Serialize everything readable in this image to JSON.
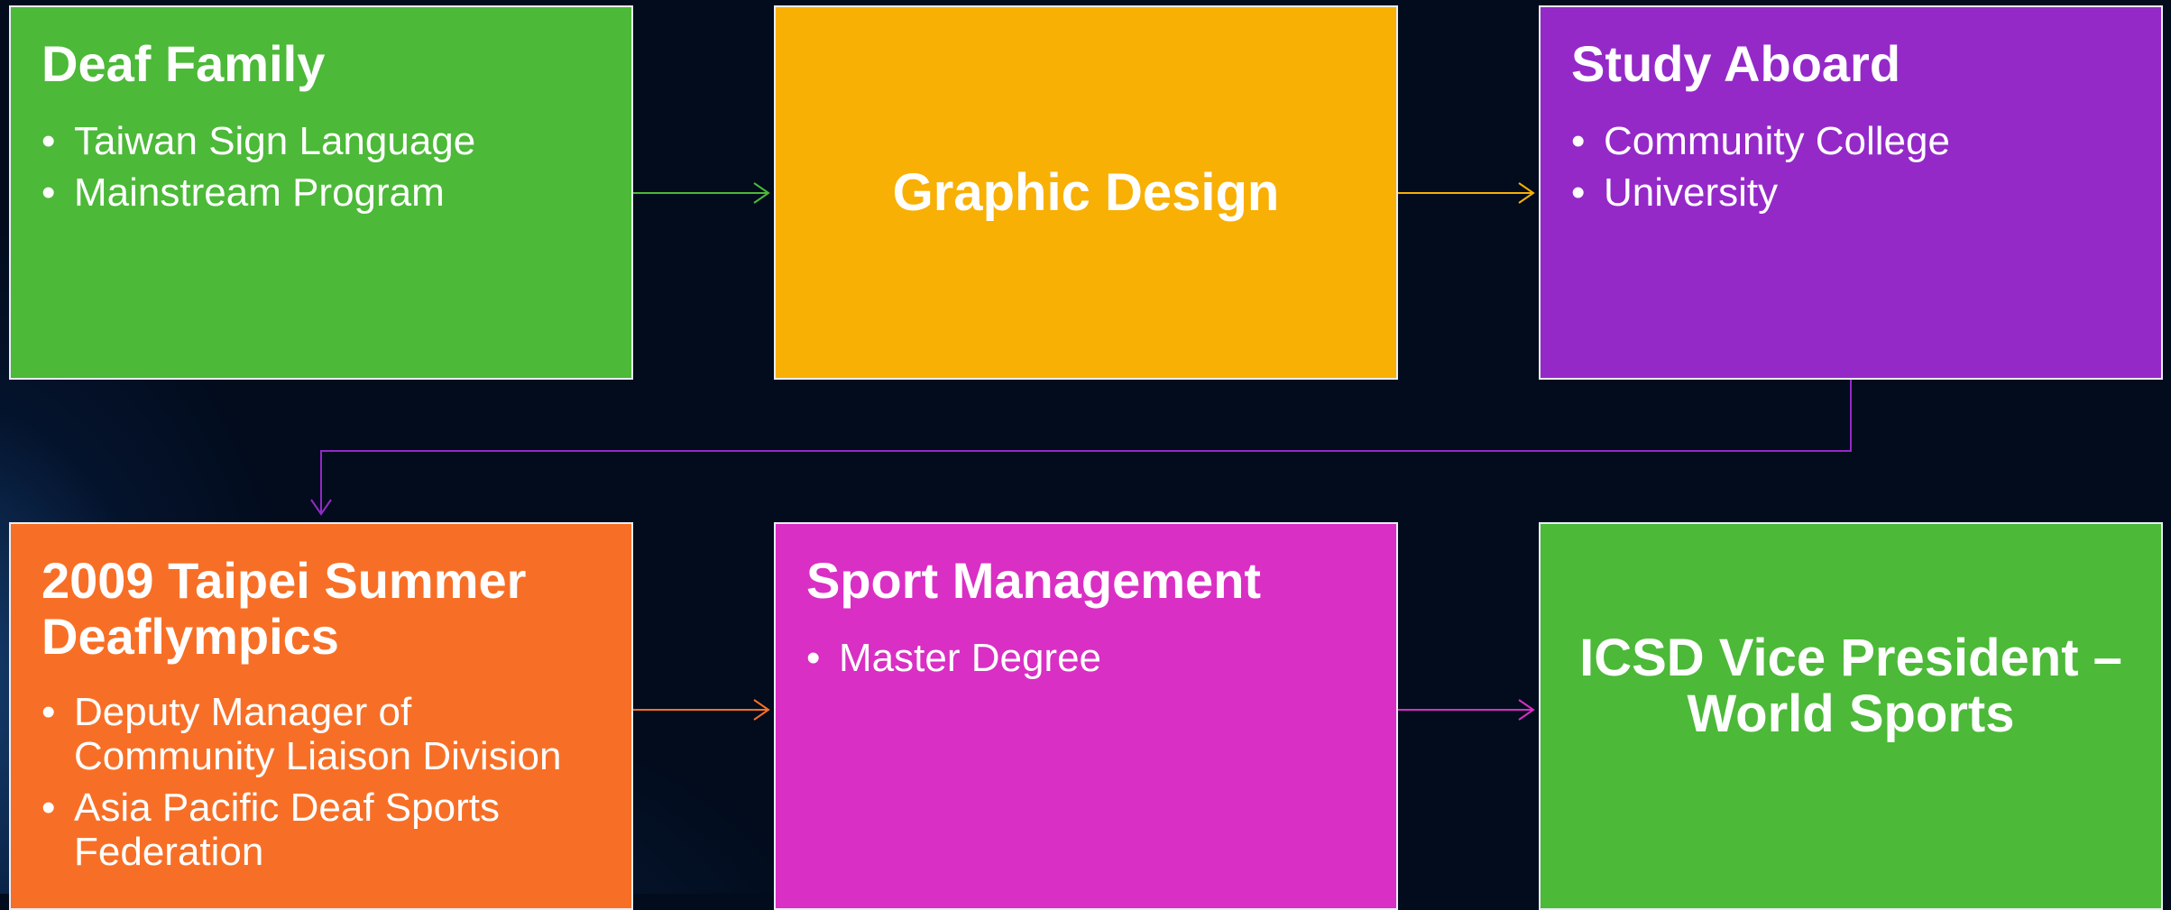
{
  "colors": {
    "background": "#020c1d",
    "green": "#4cb938",
    "yellow": "#f8b005",
    "purple": "#9429c8",
    "orange": "#f76f26",
    "magenta": "#d92fc4",
    "border": "#e8eef5"
  },
  "nodes": {
    "deaf_family": {
      "title": "Deaf Family",
      "bullets": [
        "Taiwan Sign Language",
        "Mainstream Program"
      ]
    },
    "graphic_design": {
      "title": "Graphic Design"
    },
    "study_aboard": {
      "title": "Study Aboard",
      "bullets": [
        "Community College",
        "University"
      ]
    },
    "deaflympics": {
      "title": "2009 Taipei Summer Deaflympics",
      "bullets": [
        "Deputy Manager of Community Liaison Division",
        "Asia Pacific Deaf Sports Federation"
      ]
    },
    "sport_management": {
      "title": "Sport Management",
      "bullets": [
        "Master Degree"
      ]
    },
    "icsd_vp": {
      "title": "ICSD Vice President – World Sports"
    }
  },
  "edges": [
    {
      "from": "deaf_family",
      "to": "graphic_design",
      "color": "#4cb938"
    },
    {
      "from": "graphic_design",
      "to": "study_aboard",
      "color": "#f8b005"
    },
    {
      "from": "study_aboard",
      "to": "deaflympics",
      "color": "#9429c8"
    },
    {
      "from": "deaflympics",
      "to": "sport_management",
      "color": "#f76f26"
    },
    {
      "from": "sport_management",
      "to": "icsd_vp",
      "color": "#d92fc4"
    }
  ]
}
